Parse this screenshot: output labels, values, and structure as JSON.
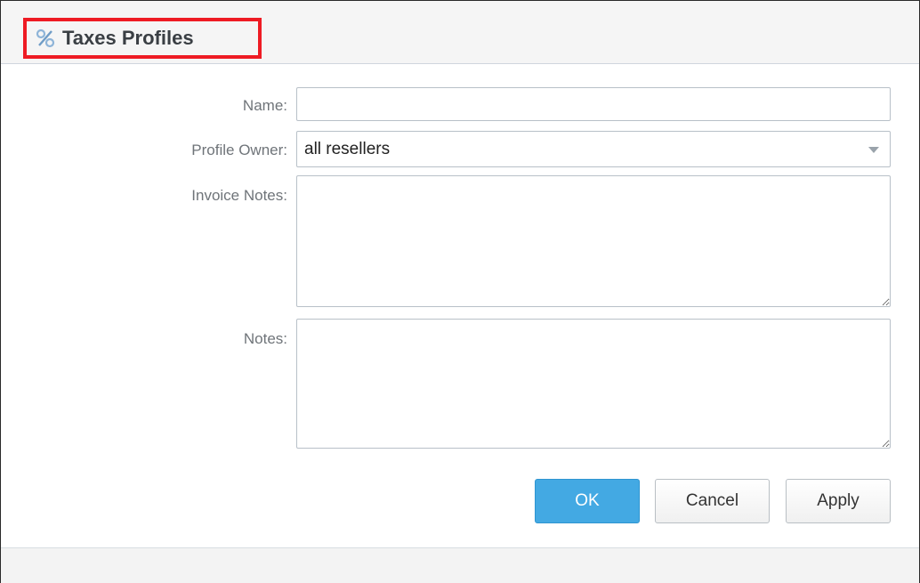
{
  "window": {
    "title": "Taxes Profiles",
    "title_icon": "percent-icon"
  },
  "form": {
    "name": {
      "label": "Name:",
      "value": ""
    },
    "profile_owner": {
      "label": "Profile Owner:",
      "value": "all resellers"
    },
    "invoice_notes": {
      "label": "Invoice Notes:",
      "value": ""
    },
    "notes": {
      "label": "Notes:",
      "value": ""
    }
  },
  "buttons": {
    "ok": "OK",
    "cancel": "Cancel",
    "apply": "Apply"
  },
  "colors": {
    "highlight_border": "#ee1b24",
    "primary_button": "#43a9e3",
    "title_text": "#3a3f44",
    "label_text": "#6f7479"
  }
}
